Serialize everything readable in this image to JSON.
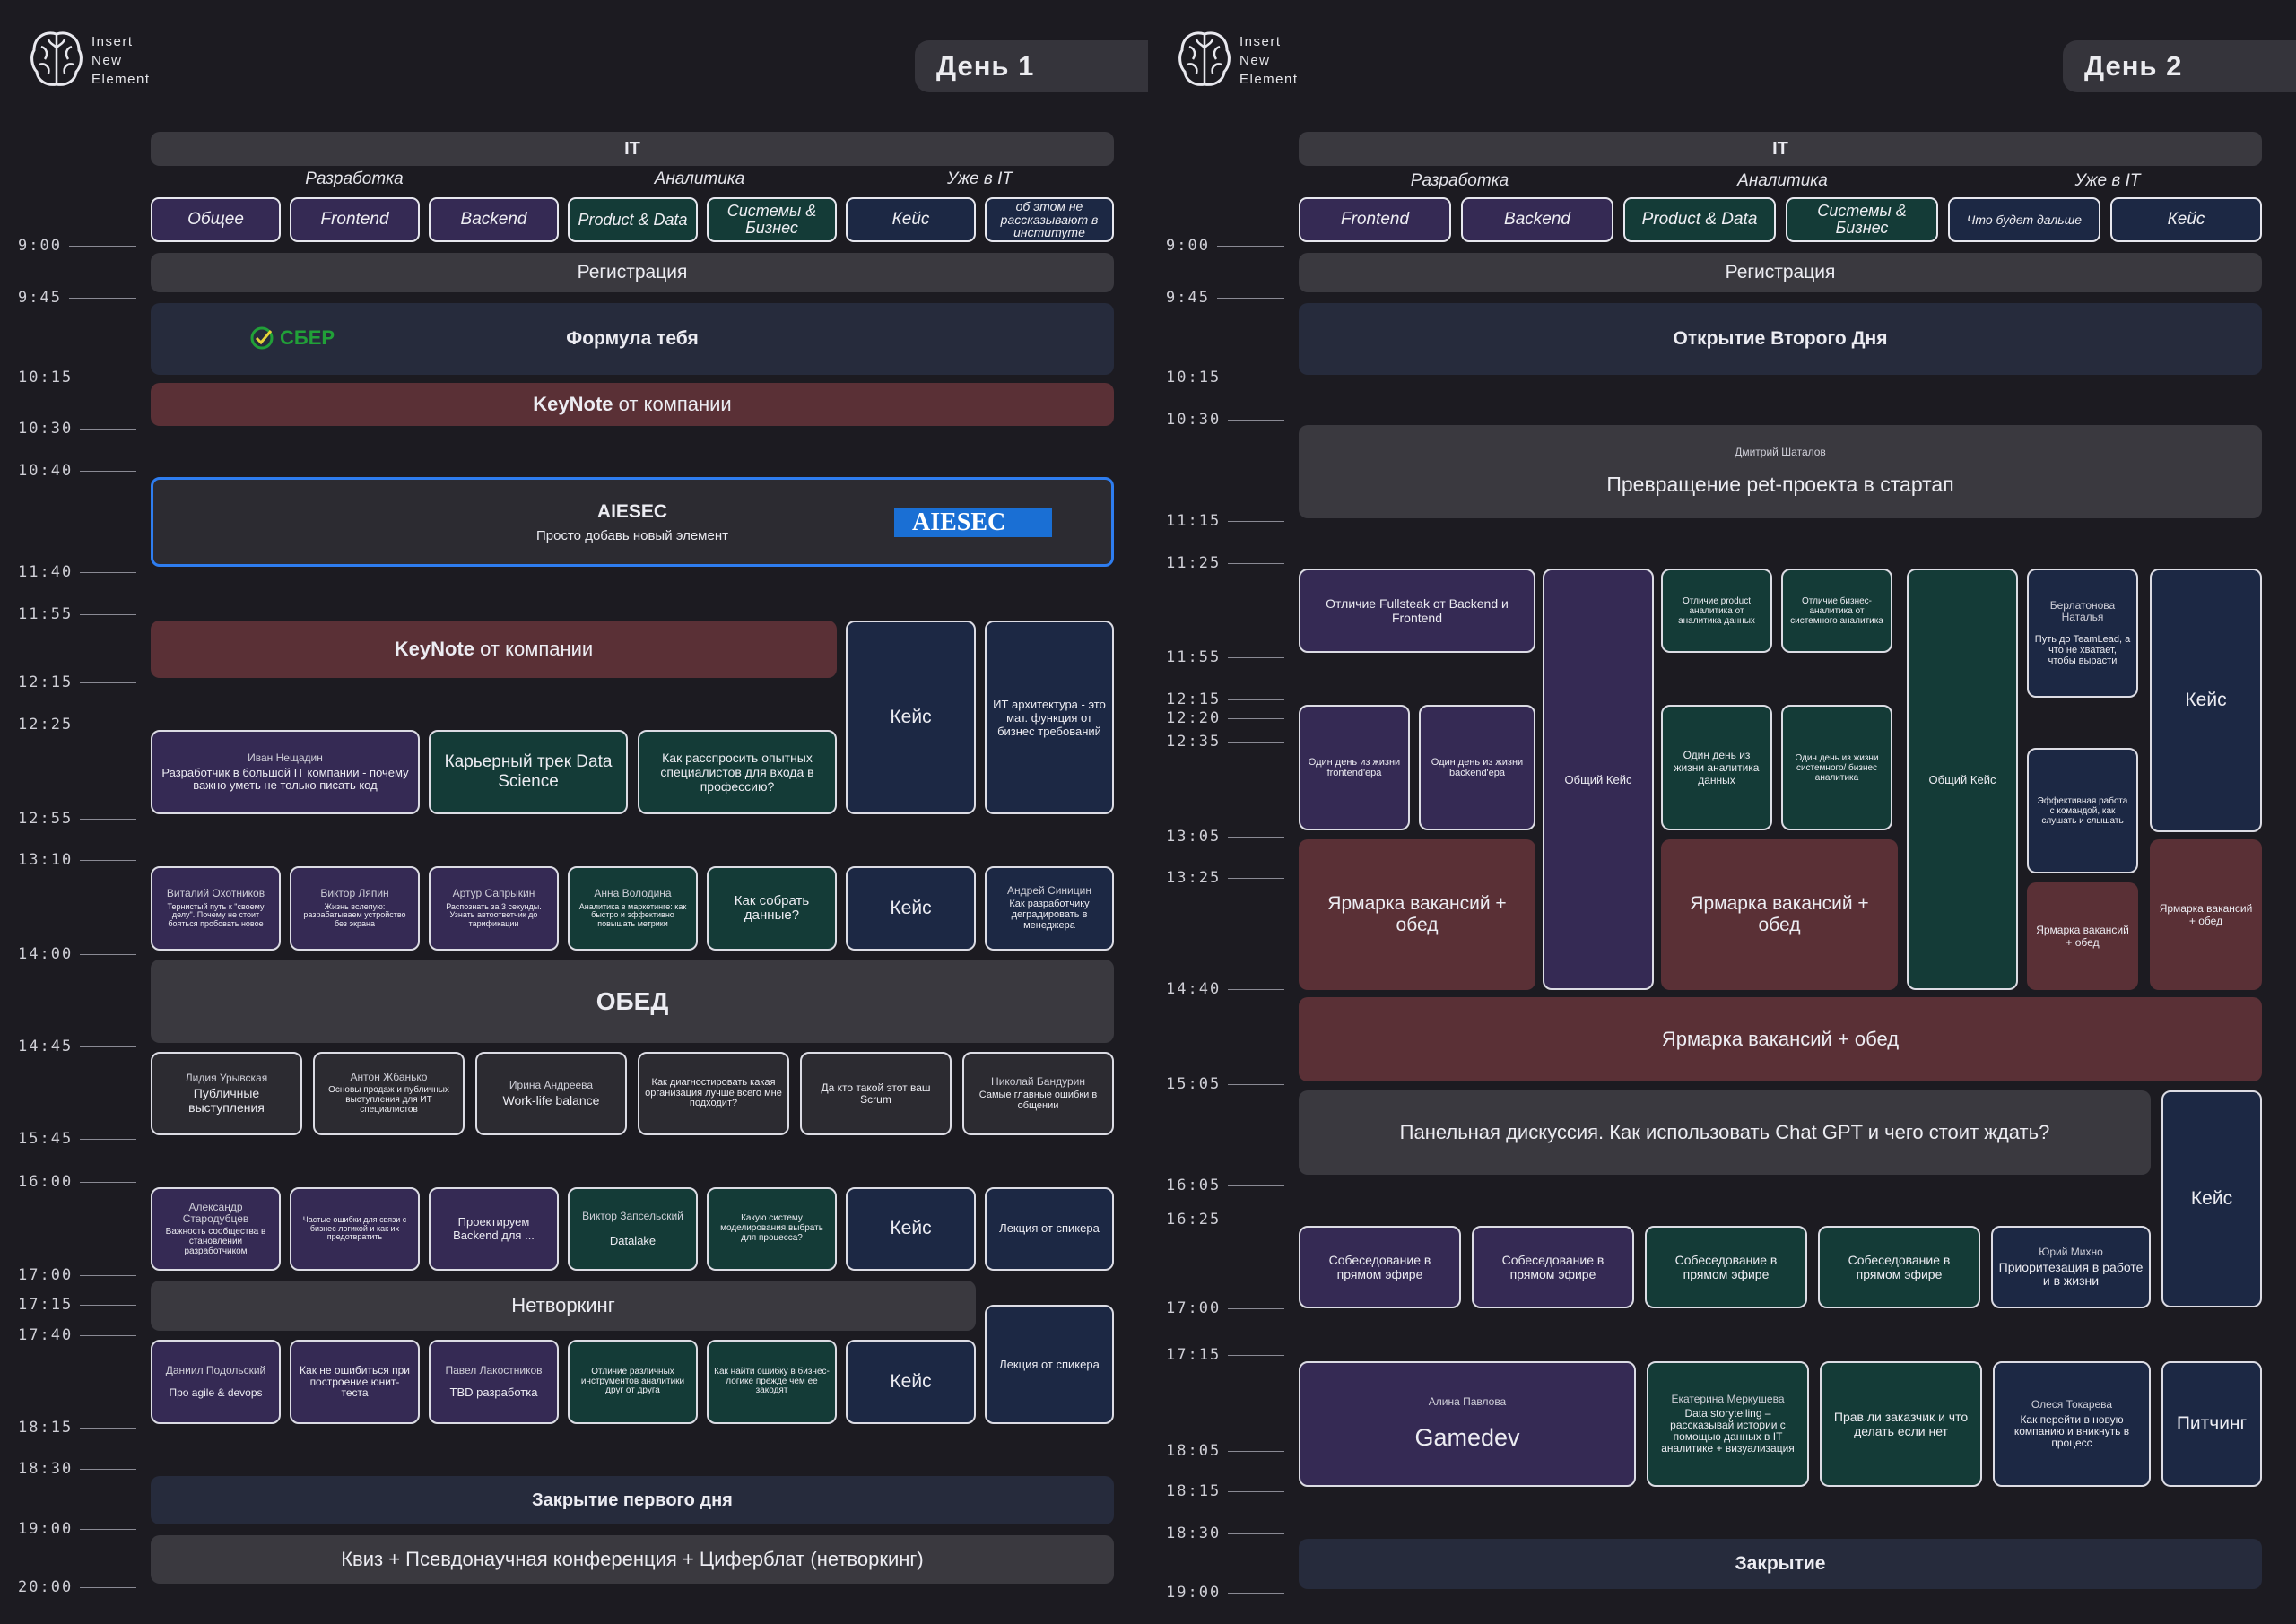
{
  "logo": {
    "line1": "Insert",
    "line2": "New",
    "line3": "Element"
  },
  "day1": {
    "title": "День 1",
    "times": [
      "9:00",
      "9:45",
      "10:15",
      "10:30",
      "10:40",
      "11:40",
      "11:55",
      "12:15",
      "12:25",
      "12:55",
      "13:10",
      "14:00",
      "14:45",
      "15:45",
      "16:00",
      "17:00",
      "17:15",
      "17:40",
      "18:15",
      "18:30",
      "19:00",
      "20:00"
    ],
    "top_bar": "IT",
    "sections": [
      "Разработка",
      "Аналитика",
      "Уже в IT"
    ],
    "categories": [
      "Общее",
      "Frontend",
      "Backend",
      "Product & Data",
      "Системы & Бизнес",
      "Кейс",
      "об этом не рассказывают в институте"
    ],
    "registration": "Регистрация",
    "sber_logo": "СБЕР",
    "formula": "Формула тебя",
    "keynote1_bold": "KeyNote",
    "keynote1_rest": " от компании",
    "aiesec_title": "AIESEC",
    "aiesec_subtitle": "Просто добавь новый элемент",
    "aiesec_logo": "AIESEC",
    "keynote2_bold": "KeyNote",
    "keynote2_rest": " от компании",
    "case": "Кейс",
    "it_arch": "ИТ архитектура - это мат. функция от бизнес требований",
    "s1_speaker": "Иван Нещадин",
    "s1_title": "Разработчик в большой IT компании - почему важно уметь не только писать код",
    "career": "Карьерный трек Data Science",
    "how_ask": "Как расспросить опытных специалистов для входа в профессию?",
    "r2": [
      {
        "speaker": "Виталий Охотников",
        "title": "Тернистый путь к \"своему делу\". Почему не стоит бояться пробовать новое"
      },
      {
        "speaker": "Виктор Ляпин",
        "title": "Жизнь вслепую: разрабатываем устройство без экрана"
      },
      {
        "speaker": "Артур Сапрыкин",
        "title": "Распознать за 3 секунды. Узнать автоответчик до тарификации"
      },
      {
        "speaker": "Анна Володина",
        "title": "Аналитика в маркетинге: как быстро и эффективно повышать метрики"
      },
      {
        "speaker": "",
        "title": "Как собрать данные?"
      },
      {
        "speaker": "",
        "title": "Кейс"
      },
      {
        "speaker": "Андрей Синицин",
        "title": "Как разработчику деградировать в менеджера"
      }
    ],
    "lunch": "ОБЕД",
    "r3": [
      {
        "speaker": "Лидия Урывская",
        "title": "Публичные выступления"
      },
      {
        "speaker": "Антон Жбанько",
        "title": "Основы продаж и публичных выступления для ИТ специалистов"
      },
      {
        "speaker": "Ирина Андреева",
        "title": "Work-life balance"
      },
      {
        "speaker": "",
        "title": "Как диагностировать какая организация лучше всего мне подходит?"
      },
      {
        "speaker": "",
        "title": "Да кто такой этот ваш Scrum"
      },
      {
        "speaker": "Николай Бандурин",
        "title": "Самые главные ошибки в общении"
      }
    ],
    "r4": [
      {
        "speaker": "Александр Стародубцев",
        "title": "Важность сообщества в становлении разработчиком"
      },
      {
        "speaker": "",
        "title": "Частые ошибки для связи с бизнес логикой и как их предотвратить"
      },
      {
        "speaker": "",
        "title": "Проектируем Backend для ..."
      },
      {
        "speaker": "Виктор Запсельский",
        "title": "Datalake"
      },
      {
        "speaker": "",
        "title": "Какую систему моделирования выбрать для процесса?"
      },
      {
        "speaker": "",
        "title": "Кейс"
      },
      {
        "speaker": "",
        "title": "Лекция от спикера"
      }
    ],
    "networking": "Нетворкинг",
    "r5": [
      {
        "speaker": "Даниил Подольский",
        "title": "Про agile & devops"
      },
      {
        "speaker": "",
        "title": "Как не ошибиться при построение юнит-теста"
      },
      {
        "speaker": "Павел Лакостников",
        "title": "TBD разработка"
      },
      {
        "speaker": "",
        "title": "Отличие различных инструментов аналитики друг от друга"
      },
      {
        "speaker": "",
        "title": "Как найти ошибку в бизнес-логике прежде чем ее закодят"
      },
      {
        "speaker": "",
        "title": "Кейс"
      }
    ],
    "lecture2": "Лекция от спикера",
    "closing": "Закрытие первого дня",
    "quiz": "Квиз + Псевдонаучная конференция + Циферблат (нетворкинг)"
  },
  "day2": {
    "title": "День 2",
    "times": [
      "9:00",
      "9:45",
      "10:15",
      "10:30",
      "11:15",
      "11:25",
      "11:55",
      "12:15",
      "12:20",
      "12:35",
      "13:05",
      "13:25",
      "14:40",
      "15:05",
      "16:05",
      "16:25",
      "17:00",
      "17:15",
      "18:05",
      "18:15",
      "18:30",
      "19:00"
    ],
    "top_bar": "IT",
    "sections": [
      "Разработка",
      "Аналитика",
      "Уже в IT"
    ],
    "categories": [
      "Frontend",
      "Backend",
      "Product & Data",
      "Системы & Бизнес",
      "Что будет дальше",
      "Кейс"
    ],
    "registration": "Регистрация",
    "opening": "Открытие Второго Дня",
    "pet_speaker": "Дмитрий Шаталов",
    "pet_title": "Превращение pet-проекта в стартап",
    "fullstack": "Отличие Fullsteak от Backend и Frontend",
    "common_case": "Общий Кейс",
    "pa_diff": "Отличие product аналитика от аналитика данных",
    "ba_diff": "Отличие бизнес-аналитика от системного аналитика",
    "teamlead_speaker": "Берлатонова Наталья",
    "teamlead_title": "Путь до TeamLead, а что не хватает, чтобы вырасти",
    "case": "Кейс",
    "day_front": "Один день из жизни frontend'ера",
    "day_back": "Один день из жизни backend'ера",
    "day_da": "Один день из жизни аналитика данных",
    "day_sa": "Один день из жизни системного/ бизнес аналитика",
    "team_work": "Эффективная работа с командой, как слушать и слышать",
    "fair": "Ярмарка вакансий + обед",
    "panel": "Панельная дискуссия. Как использовать Chat GPT и чего стоит ждать?",
    "interview": "Собеседование в прямом эфире",
    "mikhno_speaker": "Юрий Михно",
    "mikhno_title": "Приоритезация в работе и в жизни",
    "pavlova_speaker": "Алина Павлова",
    "gamedev": "Gamedev",
    "merkusheva_speaker": "Екатерина Меркушева",
    "merkusheva_title": "Data storytelling – рассказывай истории с помощью данных в IT аналитике + визуализация",
    "rights": "Прав ли заказчик и что делать если нет",
    "tokareva_speaker": "Олеся Токарева",
    "tokareva_title": "Как перейти в новую компанию и вникнуть в процесс",
    "pitch": "Питчинг",
    "closing": "Закрытие"
  }
}
